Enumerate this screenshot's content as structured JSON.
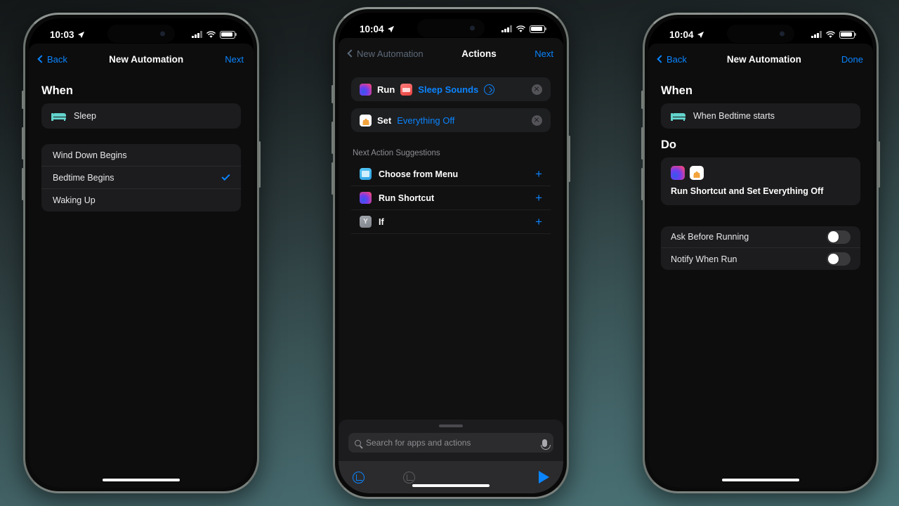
{
  "background": {
    "top_color": "#141718",
    "bottom_color": "#4b7578"
  },
  "accent": {
    "blue": "#0a84ff",
    "teal": "#63d3cc",
    "gray": "#8e8e93"
  },
  "phones": [
    {
      "id": "phone1",
      "status_bar": {
        "time": "10:03",
        "location_icon": "location-arrow-icon",
        "cellular_icon": "cellular-bars-icon",
        "wifi_icon": "wifi-icon",
        "battery_icon": "battery-icon"
      },
      "nav": {
        "back_label": "Back",
        "title": "New Automation",
        "action_label": "Next"
      },
      "when": {
        "heading": "When",
        "trigger_icon": "bed-icon",
        "trigger_label": "Sleep"
      },
      "options": [
        {
          "label": "Wind Down Begins",
          "selected": false
        },
        {
          "label": "Bedtime Begins",
          "selected": true
        },
        {
          "label": "Waking Up",
          "selected": false
        }
      ]
    },
    {
      "id": "phone2",
      "status_bar": {
        "time": "10:04",
        "location_icon": "location-arrow-icon",
        "cellular_icon": "cellular-bars-icon",
        "wifi_icon": "wifi-icon",
        "battery_icon": "battery-icon"
      },
      "nav": {
        "back_label": "New Automation",
        "title": "Actions",
        "action_label": "Next"
      },
      "actions": [
        {
          "verb": "Run",
          "app_icon": "shortcuts-icon",
          "item_icon": "sleep-sounds-icon",
          "item_label": "Sleep Sounds",
          "has_disclosure": true,
          "remove_icon": "remove-circle-icon"
        },
        {
          "verb": "Set",
          "app_icon": "home-icon",
          "item_label": "Everything Off",
          "has_disclosure": false,
          "remove_icon": "remove-circle-icon"
        }
      ],
      "suggestions": {
        "heading": "Next Action Suggestions",
        "items": [
          {
            "icon": "choose-from-menu-icon",
            "label": "Choose from Menu",
            "add_icon": "plus-icon"
          },
          {
            "icon": "shortcuts-icon",
            "label": "Run Shortcut",
            "add_icon": "plus-icon"
          },
          {
            "icon": "if-icon",
            "label": "If",
            "add_icon": "plus-icon"
          }
        ]
      },
      "search": {
        "placeholder": "Search for apps and actions",
        "search_icon": "search-icon",
        "mic_icon": "microphone-icon"
      },
      "toolbar": {
        "undo_icon": "undo-icon",
        "redo_icon": "redo-icon",
        "play_icon": "play-icon"
      }
    },
    {
      "id": "phone3",
      "status_bar": {
        "time": "10:04",
        "location_icon": "location-arrow-icon",
        "cellular_icon": "cellular-bars-icon",
        "wifi_icon": "wifi-icon",
        "battery_icon": "battery-icon"
      },
      "nav": {
        "back_label": "Back",
        "title": "New Automation",
        "action_label": "Done"
      },
      "when": {
        "heading": "When",
        "trigger_icon": "bed-icon",
        "trigger_label": "When Bedtime starts"
      },
      "do": {
        "heading": "Do",
        "icons": [
          "shortcuts-icon",
          "home-icon"
        ],
        "summary": "Run Shortcut and Set Everything Off"
      },
      "toggles": [
        {
          "label": "Ask Before Running",
          "on": false
        },
        {
          "label": "Notify When Run",
          "on": false
        }
      ]
    }
  ]
}
